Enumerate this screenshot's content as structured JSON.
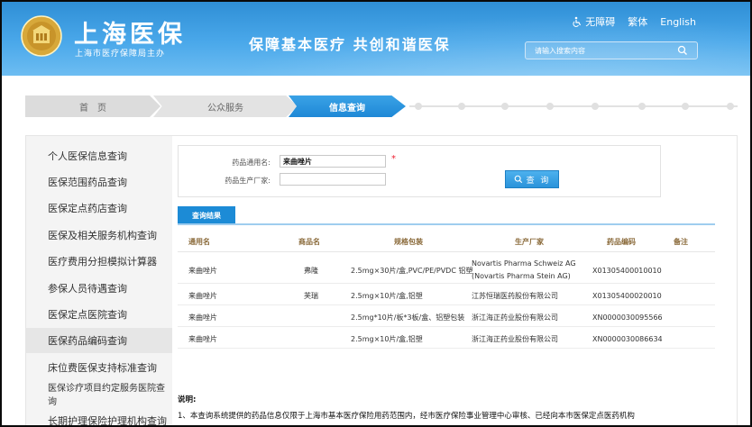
{
  "header": {
    "title": "上海医保",
    "subtitle": "上海市医疗保障局主办",
    "slogan": "保障基本医疗  共创和谐医保",
    "links": {
      "accessibility": "无障碍",
      "traditional": "繁体",
      "english": "English"
    },
    "search_placeholder": "请输入搜索内容"
  },
  "breadcrumb": {
    "home": "首　页",
    "service": "公众服务",
    "current": "信息查询"
  },
  "sidebar": {
    "items": [
      {
        "label": "个人医保信息查询"
      },
      {
        "label": "医保范围药品查询"
      },
      {
        "label": "医保定点药店查询"
      },
      {
        "label": "医保及相关服务机构查询"
      },
      {
        "label": "医疗费用分担模拟计算器"
      },
      {
        "label": "参保人员待遇查询"
      },
      {
        "label": "医保定点医院查询"
      },
      {
        "label": "医保药品编码查询"
      },
      {
        "label": "床位费医保支持标准查询"
      },
      {
        "label": "医保诊疗项目约定服务医院查询"
      },
      {
        "label": "长期护理保险护理机构查询"
      }
    ],
    "active_index": 7
  },
  "form": {
    "generic_name_label": "药品通用名:",
    "generic_name_value": "来曲唑片",
    "manufacturer_label": "药品生产厂家:",
    "manufacturer_value": "",
    "required_mark": "*",
    "query_label": "查 询"
  },
  "results": {
    "tab_label": "查询结果",
    "columns": [
      "通用名",
      "商品名",
      "规格包装",
      "生产厂家",
      "药品编码",
      "备注"
    ],
    "rows": [
      {
        "generic": "来曲唑片",
        "brand": "弗隆",
        "spec": "2.5mg×30片/盒,PVC/PE/PVDC 铝塑",
        "maker_line1": "Novartis Pharma Schweiz AG",
        "maker_line2": "(Novartis Pharma Stein AG)",
        "code": "X01305400010010",
        "note": ""
      },
      {
        "generic": "来曲唑片",
        "brand": "芙瑞",
        "spec": "2.5mg×10片/盒,铝塑",
        "maker_line1": "江苏恒瑞医药股份有限公司",
        "maker_line2": "",
        "code": "X01305400020010",
        "note": ""
      },
      {
        "generic": "来曲唑片",
        "brand": "",
        "spec": "2.5mg*10片/板*3板/盒、铝塑包装",
        "maker_line1": "浙江海正药业股份有限公司",
        "maker_line2": "",
        "code": "XN0000030095566",
        "note": ""
      },
      {
        "generic": "来曲唑片",
        "brand": "",
        "spec": "2.5mg×10片/盒,铝塑",
        "maker_line1": "浙江海正药业股份有限公司",
        "maker_line2": "",
        "code": "XN0000030086634",
        "note": ""
      }
    ]
  },
  "notes": {
    "title": "说明:",
    "line1": "1、本查询系统提供的药品信息仅限于上海市基本医疗保险用药范围内，经市医疗保险事业管理中心审核、已经向本市医保定点医药机构"
  },
  "colors": {
    "brand_blue": "#1c8bd6",
    "header_blue": "#3b9be0"
  }
}
